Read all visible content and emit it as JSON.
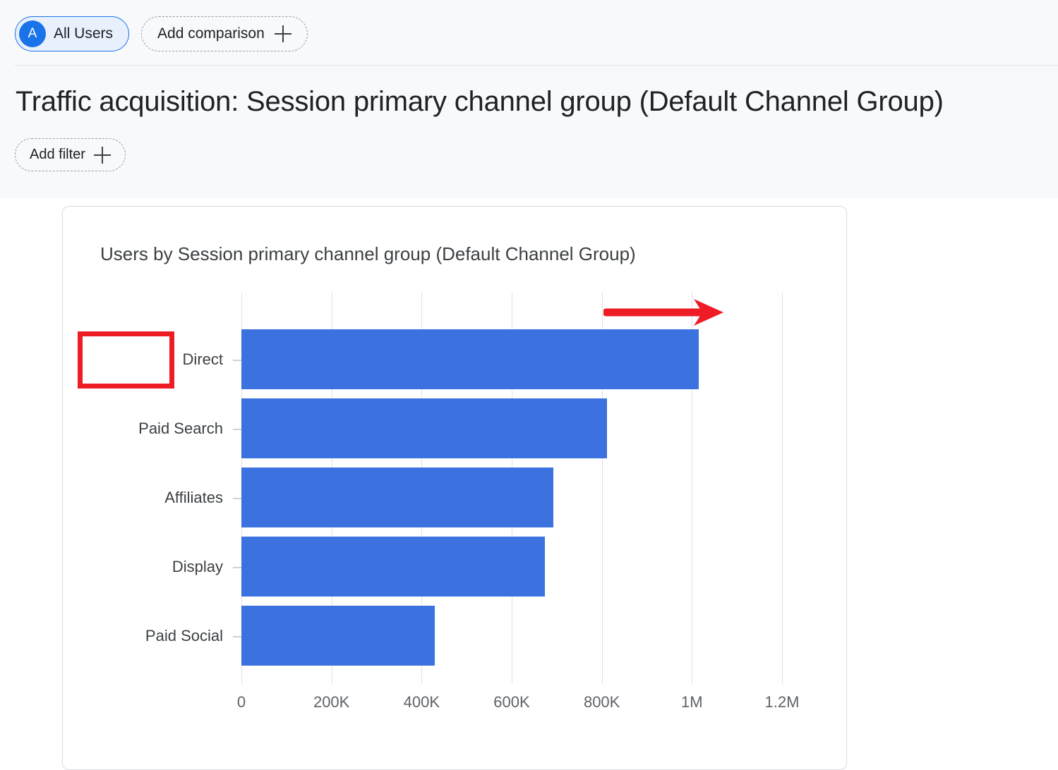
{
  "header": {
    "comparison_chip": {
      "avatar_letter": "A",
      "label": "All Users"
    },
    "add_comparison_label": "Add comparison",
    "plus_icon": "plus-icon"
  },
  "page_title": "Traffic acquisition: Session primary channel group (Default Channel Group)",
  "filters": {
    "add_filter_label": "Add filter"
  },
  "card": {
    "chart_title": "Users by Session primary channel group (Default Channel Group)"
  },
  "annotations": {
    "highlight_box_target": "Direct",
    "arrow_direction": "right",
    "highlight_color": "#ee1c25"
  },
  "colors": {
    "bar": "#3b72df",
    "accent": "#1a73e8",
    "page_background": "#f8f9fa",
    "card_background": "#ffffff",
    "gridline": "#e0e0e0"
  },
  "chart_data": {
    "type": "bar",
    "orientation": "horizontal",
    "title": "Users by Session primary channel group (Default Channel Group)",
    "xlabel": "",
    "ylabel": "",
    "categories": [
      "Direct",
      "Paid Search",
      "Affiliates",
      "Display",
      "Paid Social"
    ],
    "values": [
      1015000,
      812000,
      692000,
      673000,
      430000
    ],
    "xlim": [
      0,
      1200000
    ],
    "xticks": [
      0,
      200000,
      400000,
      600000,
      800000,
      1000000,
      1200000
    ],
    "xtick_labels": [
      "0",
      "200K",
      "400K",
      "600K",
      "800K",
      "1M",
      "1.2M"
    ],
    "grid": true,
    "legend": false,
    "series": [
      {
        "name": "Users",
        "values": [
          1015000,
          812000,
          692000,
          673000,
          430000
        ]
      }
    ]
  }
}
